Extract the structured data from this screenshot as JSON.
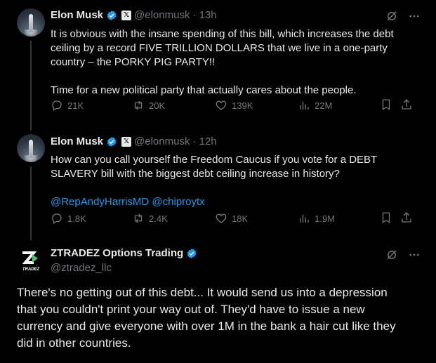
{
  "posts": [
    {
      "name": "Elon Musk",
      "handle": "@elonmusk",
      "time": "· 13h",
      "paragraphs": [
        "It is obvious with the insane spending of this bill, which increases the debt ceiling by a record FIVE TRILLION DOLLARS that we live in a one-party country – the PORKY PIG PARTY!!",
        "Time for a new political party that actually cares about the people."
      ],
      "replies": "21K",
      "reposts": "20K",
      "likes": "139K",
      "views": "22M"
    },
    {
      "name": "Elon Musk",
      "handle": "@elonmusk",
      "time": "· 12h",
      "paragraphs": [
        "How can you call yourself the Freedom Caucus if you vote for a DEBT SLAVERY bill with the biggest debt ceiling increase in history?"
      ],
      "mentions": "@RepAndyHarrisMD @chiproytx",
      "replies": "1.8K",
      "reposts": "2.4K",
      "likes": "18K",
      "views": "1.9M"
    },
    {
      "name": "ZTRADEZ Options Trading",
      "handle": "@ztradez_llc",
      "logo_text": "TRADEZ",
      "body": "There's no getting out of this debt... It would send us into a depression that you couldn't print your way out of. They'd have to issue a new currency and give everyone with over 1M in the bank a hair cut like they did in other countries."
    }
  ],
  "icons": {
    "verified": "verified-badge-icon",
    "affiliate": "x-affiliate-icon",
    "grok": "grok-icon",
    "more": "more-icon"
  },
  "colors": {
    "background": "#000000",
    "text": "#e7e9ea",
    "muted": "#71767b",
    "accent": "#1d9bf0"
  }
}
